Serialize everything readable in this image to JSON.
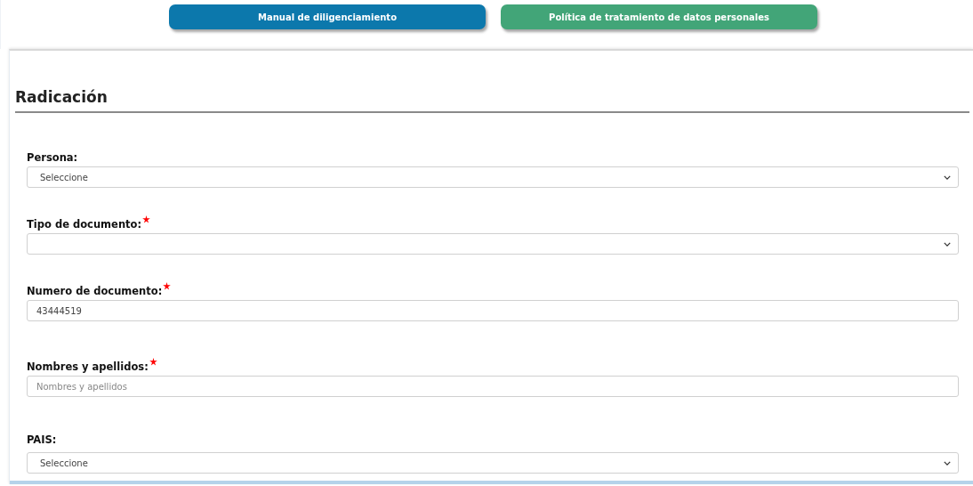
{
  "header_buttons": [
    {
      "label": "Manual de diligenciamiento",
      "kind": "primary"
    },
    {
      "label": "Política de tratamiento de datos personales",
      "kind": "secondary"
    }
  ],
  "section": {
    "title": "Radicación"
  },
  "fields": [
    {
      "label": "Persona:",
      "kind": "select",
      "required": false,
      "value": "Seleccione"
    },
    {
      "label": "Tipo de documento:",
      "kind": "select",
      "required": true
    },
    {
      "label": "Numero de documento:",
      "kind": "text",
      "required": true,
      "value": "43444519"
    },
    {
      "label": "Nombres y apellidos:",
      "kind": "text",
      "required": true,
      "placeholder": "Nombres y apellidos"
    },
    {
      "label": "PAIS:",
      "kind": "select",
      "required": false,
      "value": "Seleccione"
    }
  ]
}
